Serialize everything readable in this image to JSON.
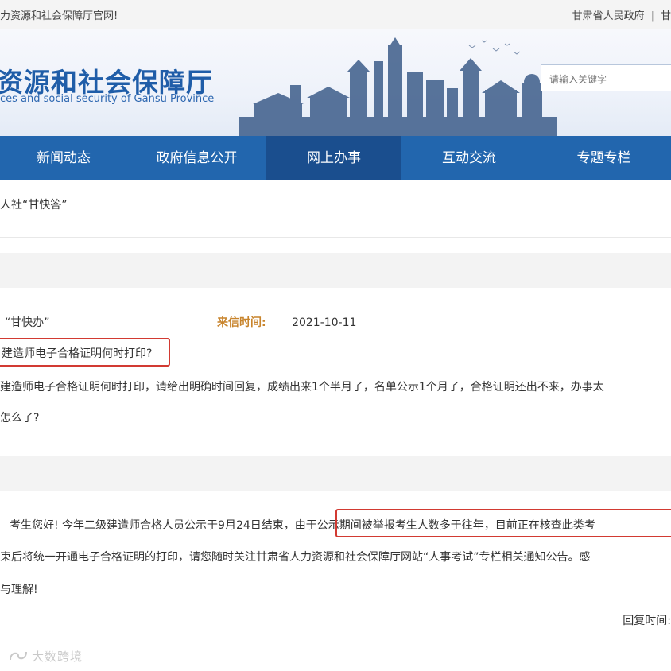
{
  "topbar": {
    "welcome": "力资源和社会保障厅官网!",
    "link_gov": "甘肃省人民政府",
    "separator": "|",
    "link_cut": "甘"
  },
  "banner": {
    "title_cn": "资源和社会保障厅",
    "title_en": "ces and social security of Gansu Province",
    "search_placeholder": "请输入关键字"
  },
  "nav": {
    "items": [
      "新闻动态",
      "政府信息公开",
      "网上办事",
      "互动交流",
      "专题专栏"
    ],
    "active_index": 2
  },
  "breadcrumb": "人社“甘快答”",
  "letter": {
    "source": "“甘快办”",
    "time_label": "来信时间:",
    "time_value": "2021-10-11",
    "question_title": "建造师电子合格证明何时打印?",
    "question_line1": "建造师电子合格证明何时打印，请给出明确时间回复，成绩出来1个半月了，名单公示1个月了，合格证明还出不来，办事太",
    "question_line2": "怎么了?"
  },
  "reply": {
    "line1": "考生您好! 今年二级建造师合格人员公示于9月24日结束，由于公示期间被举报考生人数多于往年，目前正在核查此类考",
    "line2": "束后将统一开通电子合格证明的打印，请您随时关注甘肃省人力资源和社会保障厅网站“人事考试”专栏相关通知公告。感",
    "line3": "与理解!",
    "time_label": "回复时间:"
  },
  "watermark": "大数跨境",
  "colors": {
    "nav_bg": "#2266ae",
    "nav_active": "#1a4e8e",
    "brand_blue": "#1f5da8",
    "label_orange": "#c8842c",
    "highlight_red": "#d23a32"
  }
}
